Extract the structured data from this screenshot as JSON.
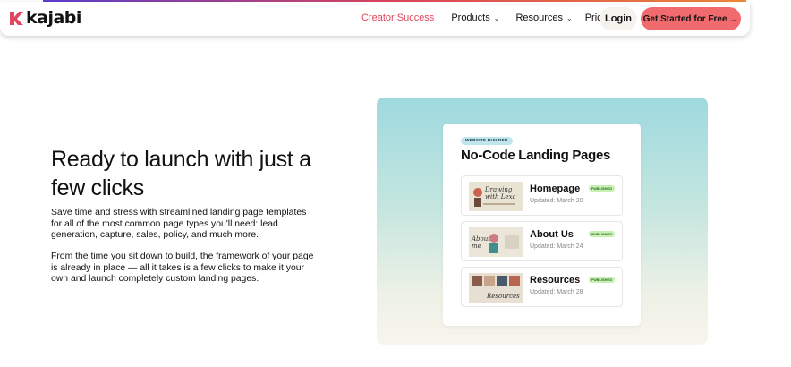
{
  "nav": {
    "brand": "kajabi",
    "links": [
      {
        "label": "Creator Success",
        "active": true
      },
      {
        "label": "Products",
        "dropdown": true
      },
      {
        "label": "Resources",
        "dropdown": true
      },
      {
        "label": "Pricing"
      }
    ],
    "login_label": "Login",
    "cta_label": "Get Started for Free →"
  },
  "hero": {
    "title": "Ready to launch with just a few clicks",
    "paragraph1": "Save time and stress with streamlined landing page templates for all of the most common page types you'll need: lead generation, capture, sales, policy, and much more.",
    "paragraph2": "From the time you sit down to build, the framework of your page is already in place — all it takes is a few clicks to make it your own and launch completely custom landing pages."
  },
  "visual": {
    "badge": "WEBSITE BUILDER",
    "title": "No-Code Landing Pages",
    "pages": [
      {
        "name": "Homepage",
        "updated": "Updated: March 20",
        "status": "PUBLISHED",
        "thumb_text": "Drawing with Lexa"
      },
      {
        "name": "About Us",
        "updated": "Updated: March 24",
        "status": "PUBLISHED",
        "thumb_text": "About me"
      },
      {
        "name": "Resources",
        "updated": "Updated: March 28",
        "status": "PUBLISHED",
        "thumb_text": "Resources"
      }
    ]
  },
  "colors": {
    "accent": "#e0465c",
    "cta": "#f16a6d",
    "published": "#c8f0b4"
  }
}
